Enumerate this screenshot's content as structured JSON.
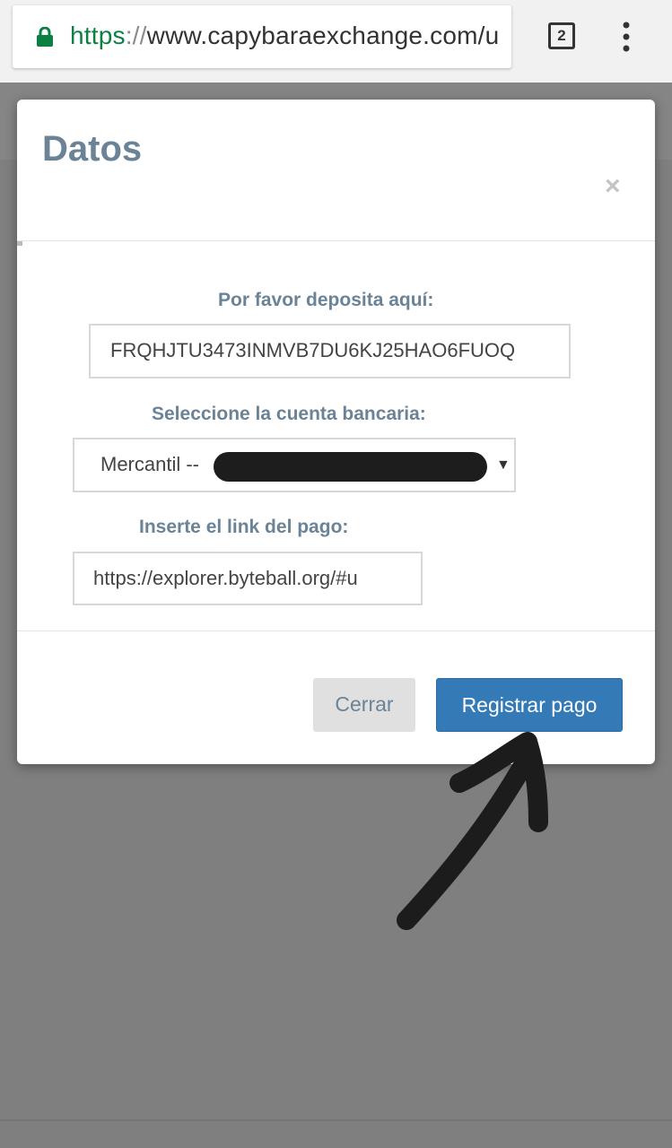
{
  "browser": {
    "url_scheme": "https",
    "url_separator": "://",
    "url_rest": "www.capybaraexchange.com/u",
    "tab_count": "2",
    "lock_icon": "lock-icon",
    "menu_icon": "more-vert-icon"
  },
  "modal": {
    "title": "Datos",
    "close_symbol": "×",
    "deposit_label": "Por favor deposita aquí:",
    "deposit_value": "FRQHJTU3473INMVB7DU6KJ25HAO6FUOQ",
    "account_label": "Seleccione la cuenta bancaria:",
    "account_selected": "Mercantil --",
    "link_label": "Inserte el link del pago:",
    "link_value": "https://explorer.byteball.org/#u",
    "cancel_button": "Cerrar",
    "submit_button": "Registrar pago"
  },
  "colors": {
    "primary": "#337ab7",
    "label": "#6a8397",
    "scheme_green": "#0b8043",
    "overlay": "#7f7f7f"
  }
}
